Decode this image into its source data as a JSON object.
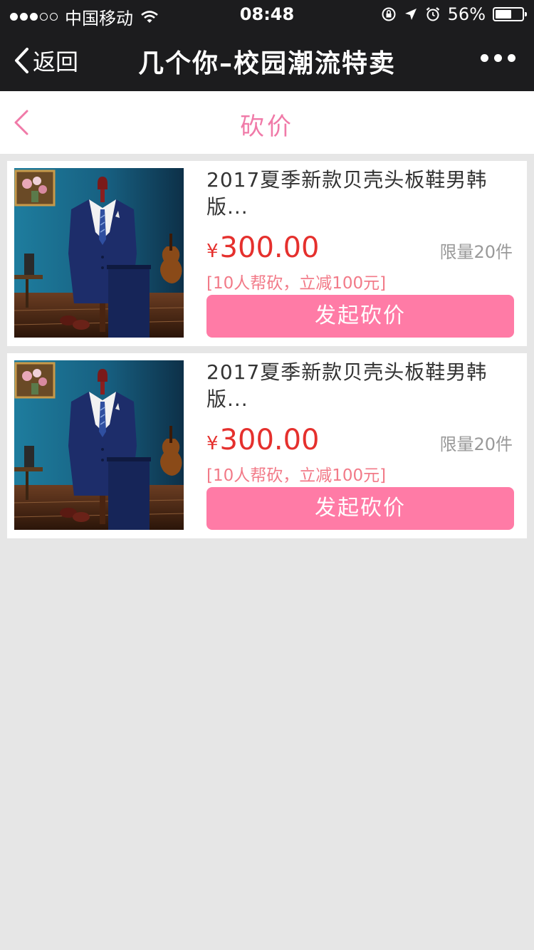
{
  "status_bar": {
    "carrier": "中国移动",
    "time": "08:48",
    "battery": "56%"
  },
  "wechat_nav": {
    "back_label": "返回",
    "title": "几个你–校园潮流特卖"
  },
  "page": {
    "title": "砍价"
  },
  "colors": {
    "accent": "#ff7ba6",
    "price": "#e5302d",
    "rule": "#f27a88"
  },
  "products": [
    {
      "title": "2017夏季新款贝壳头板鞋男韩版...",
      "currency": "¥",
      "price": "300.00",
      "limit": "限量20件",
      "rule": "[10人帮砍，立减100元]",
      "button_label": "发起砍价"
    },
    {
      "title": "2017夏季新款贝壳头板鞋男韩版...",
      "currency": "¥",
      "price": "300.00",
      "limit": "限量20件",
      "rule": "[10人帮砍，立减100元]",
      "button_label": "发起砍价"
    }
  ]
}
